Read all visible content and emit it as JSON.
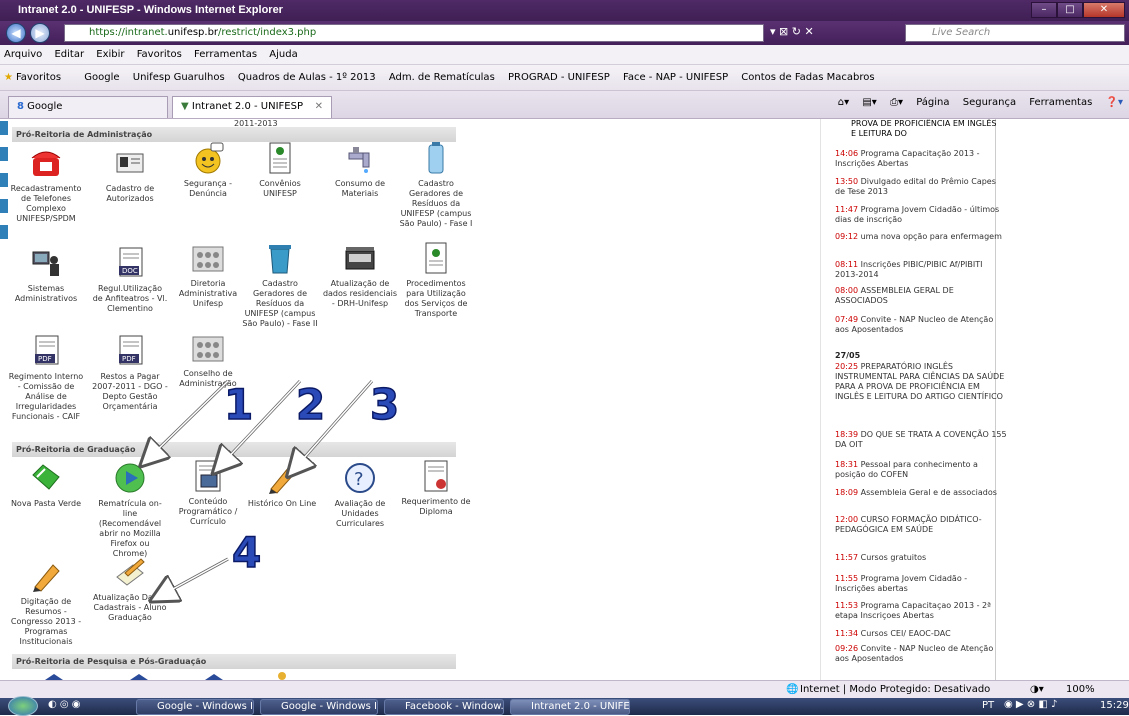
{
  "window": {
    "title": "Intranet 2.0 - UNIFESP - Windows Internet Explorer"
  },
  "address": {
    "url_prefix": "https://intranet.",
    "url_domain": "unifesp.br",
    "url_path": "/restrict/index3.php",
    "search_placeholder": "Live Search"
  },
  "menu": [
    "Arquivo",
    "Editar",
    "Exibir",
    "Favoritos",
    "Ferramentas",
    "Ajuda"
  ],
  "favorites": [
    "Favoritos",
    "Google",
    "Unifesp Guarulhos",
    "Quadros de Aulas - 1º 2013",
    "Adm. de Rematículas",
    "PROGRAD - UNIFESP",
    "Face - NAP - UNIFESP",
    "Contos de Fadas Macabros"
  ],
  "tabs": [
    {
      "label": "Google"
    },
    {
      "label": "Intranet 2.0 - UNIFESP"
    }
  ],
  "commands": [
    "Página",
    "Segurança",
    "Ferramentas"
  ],
  "content": {
    "top_cut": "2011-2013",
    "sections": {
      "admin": "Pró-Reitoria de Administração",
      "grad": "Pró-Reitoria de Graduação",
      "pesq": "Pró-Reitoria de Pesquisa e Pós-Graduação"
    },
    "admin_items": [
      "Recadastramento de Telefones Complexo UNIFESP/SPDM",
      "Cadastro de Autorizados",
      "Segurança - Denúncia",
      "Convênios UNIFESP",
      "Consumo de Materiais",
      "Cadastro Geradores de Resíduos da UNIFESP (campus São Paulo) - Fase I",
      "Sistemas Administrativos",
      "Regul.Utilização de Anfiteatros - Vl. Clementino",
      "Diretoria Administrativa Unifesp",
      "Cadastro Geradores de Resíduos da UNIFESP (campus São Paulo) - Fase II",
      "Atualização de dados residenciais - DRH-Unifesp",
      "Procedimentos para Utilização dos Serviços de Transporte",
      "Regimento Interno - Comissão de Análise de Irregularidades Funcionais - CAIF",
      "Restos a Pagar 2007-2011 - DGO - Depto Gestão Orçamentária",
      "Conselho de Administração"
    ],
    "grad_items": [
      "Nova Pasta Verde",
      "Rematrícula on-line (Recomendável abrir no Mozilla Firefox ou Chrome)",
      "Conteúdo Programático / Currículo",
      "Histórico On Line",
      "Avaliação de Unidades Curriculares",
      "Requerimento de Diploma",
      "Digitação de Resumos - Congresso 2013 - Programas Institucionais",
      "Atualização Dados Cadastrais - Aluno Graduação"
    ],
    "annotations": [
      "1",
      "2",
      "3",
      "4"
    ]
  },
  "news": {
    "top_cut": "PROVA DE PROFICIÊNCIA EM INGLÊS E LEITURA DO",
    "items_a": [
      {
        "time": "14:06",
        "text": "Programa Capacitação 2013 - Inscrições Abertas"
      },
      {
        "time": "13:50",
        "text": "Divulgado edital do Prêmio Capes de Tese 2013"
      },
      {
        "time": "11:47",
        "text": "Programa Jovem Cidadão - últimos dias de inscrição"
      },
      {
        "time": "09:12",
        "text": "uma nova opção para enfermagem"
      },
      {
        "time": "08:11",
        "text": "Inscrições PIBIC/PIBIC Af/PIBITI 2013-2014"
      },
      {
        "time": "08:00",
        "text": "ASSEMBLEIA GERAL DE ASSOCIADOS"
      },
      {
        "time": "07:49",
        "text": "Convite - NAP Nucleo de Atenção aos Aposentados"
      }
    ],
    "date": "27/05",
    "items_b": [
      {
        "time": "20:25",
        "text": "PREPARATÓRIO INGLÊS INSTRUMENTAL PARA CIÊNCIAS DA SAÚDE PARA A PROVA DE PROFICIÊNCIA EM INGLÊS E LEITURA DO ARTIGO CIENTÍFICO"
      },
      {
        "time": "18:39",
        "text": "DO QUE SE TRATA A COVENÇÃO 155 DA OIT"
      },
      {
        "time": "18:31",
        "text": "Pessoal para conhecimento a posição do COFEN"
      },
      {
        "time": "18:09",
        "text": "Assembleia Geral e de associados"
      },
      {
        "time": "12:00",
        "text": "CURSO FORMAÇÃO DIDÁTICO-PEDAGÓGICA EM SAÚDE"
      },
      {
        "time": "11:57",
        "text": "Cursos gratuitos"
      },
      {
        "time": "11:55",
        "text": "Programa Jovem Cidadão - Inscrições abertas"
      },
      {
        "time": "11:53",
        "text": "Programa Capacitaçao 2013 - 2ª etapa Inscriçoes Abertas"
      },
      {
        "time": "11:34",
        "text": "Cursos CEI/ EAOC-DAC"
      },
      {
        "time": "09:26",
        "text": "Convite - NAP Nucleo de Atenção aos Aposentados"
      }
    ]
  },
  "status": {
    "zone": "Internet | Modo Protegido: Desativado",
    "zoom": "100%"
  },
  "taskbar": {
    "items": [
      "Google - Windows I...",
      "Google - Windows I...",
      "Facebook - Window...",
      "Intranet 2.0 - UNIFE..."
    ],
    "lang": "PT",
    "clock": "15:29"
  }
}
